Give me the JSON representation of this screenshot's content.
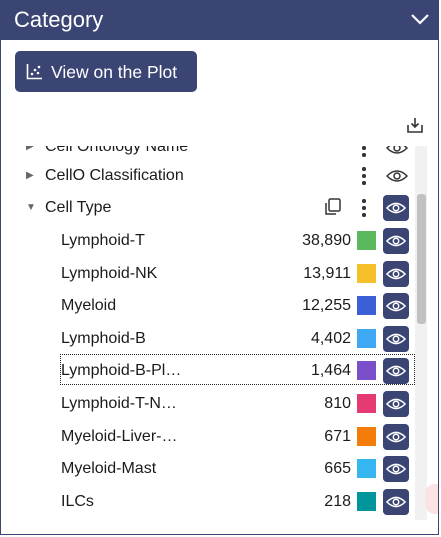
{
  "header": {
    "title": "Category"
  },
  "toolbar": {
    "view_plot_label": "View on the Plot"
  },
  "tree": {
    "partial_label": "Cell Ontology Name",
    "groups": [
      {
        "label": "CellO Classification"
      },
      {
        "label": "Cell Type"
      }
    ],
    "items": [
      {
        "label": "Lymphoid-T",
        "count": "38,890",
        "color": "#5cb85c"
      },
      {
        "label": "Lymphoid-NK",
        "count": "13,911",
        "color": "#f6c02b"
      },
      {
        "label": "Myeloid",
        "count": "12,255",
        "color": "#3c5fd8"
      },
      {
        "label": "Lymphoid-B",
        "count": "4,402",
        "color": "#3ea8f5"
      },
      {
        "label": "Lymphoid-B-Pl…",
        "count": "1,464",
        "color": "#7b4fc9"
      },
      {
        "label": "Lymphoid-T-N…",
        "count": "810",
        "color": "#e63a73"
      },
      {
        "label": "Myeloid-Liver-…",
        "count": "671",
        "color": "#f47c0b"
      },
      {
        "label": "Myeloid-Mast",
        "count": "665",
        "color": "#36b6f0"
      },
      {
        "label": "ILCs",
        "count": "218",
        "color": "#00959a"
      }
    ]
  },
  "colors": {
    "accent": "#3b4574"
  }
}
